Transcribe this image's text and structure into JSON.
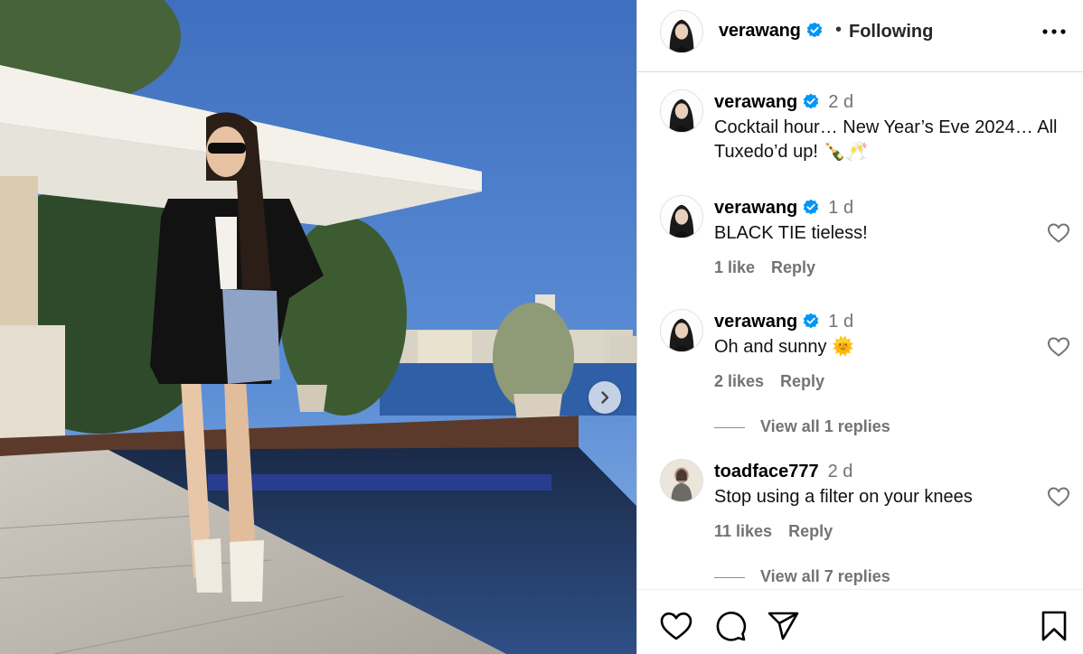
{
  "post": {
    "image": {
      "alt": ""
    }
  },
  "header": {
    "username": "verawang",
    "separator": "•",
    "follow_status": "Following"
  },
  "comments": [
    {
      "username": "verawang",
      "time": "2 d",
      "text": "Cocktail hour… New Year’s Eve 2024… All Tuxedo’d up! 🍾🥂",
      "is_caption": true
    },
    {
      "username": "verawang",
      "time": "1 d",
      "text": "BLACK TIE tieless!",
      "likes": "1 like",
      "reply": "Reply"
    },
    {
      "username": "verawang",
      "time": "1 d",
      "text": "Oh and sunny 🌞",
      "likes": "2 likes",
      "reply": "Reply",
      "view_replies": "View all 1 replies"
    },
    {
      "username": "toadface777",
      "time": "2 d",
      "text": "Stop using a filter on your knees",
      "likes": "11 likes",
      "reply": "Reply",
      "view_replies": "View all 7 replies"
    }
  ],
  "icons": {
    "verified": "verified-badge-icon",
    "more": "more-options-icon",
    "like": "heart-icon",
    "comment": "comment-bubble-icon",
    "share": "paper-plane-icon",
    "save": "bookmark-icon",
    "next": "chevron-right-icon"
  },
  "colors": {
    "verified_blue": "#0095f6",
    "secondary_text": "#737373",
    "divider": "#dbdbdb"
  }
}
